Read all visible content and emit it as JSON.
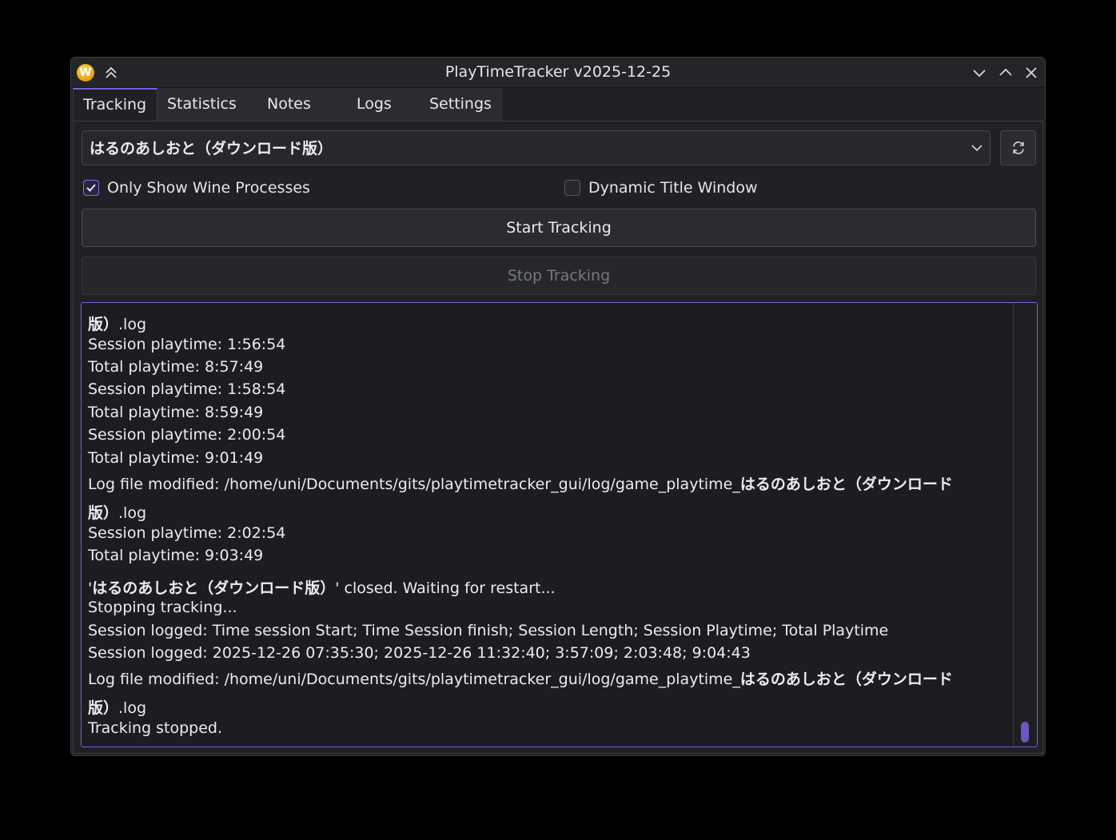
{
  "window": {
    "title": "PlayTimeTracker v2025-12-25",
    "app_icon_letter": "W",
    "icons": {
      "app": "wine-app-icon",
      "keep_above": "double-chevron-up-icon",
      "minimize": "chevron-down-icon",
      "maximize": "chevron-up-icon",
      "close": "close-icon"
    }
  },
  "tabs": [
    {
      "label": "Tracking",
      "active": true
    },
    {
      "label": "Statistics",
      "active": false
    },
    {
      "label": "Notes",
      "active": false
    },
    {
      "label": "Logs",
      "active": false
    },
    {
      "label": "Settings",
      "active": false
    }
  ],
  "tracking": {
    "process_select": {
      "selected": "はるのあしおと（ダウンロード版）",
      "arrow_icon": "chevron-down-icon"
    },
    "refresh_icon": "refresh-icon",
    "only_wine": {
      "label": "Only Show Wine Processes",
      "checked": true
    },
    "dynamic_title": {
      "label": "Dynamic Title Window",
      "checked": false
    },
    "start_label": "Start Tracking",
    "stop_label": "Stop Tracking",
    "stop_enabled": false
  },
  "log": {
    "lines": [
      "版）.log",
      "Session playtime: 1:56:54",
      "Total playtime: 8:57:49",
      "Session playtime: 1:58:54",
      "Total playtime: 8:59:49",
      "Session playtime: 2:00:54",
      "Total playtime: 9:01:49",
      "Log file modified: /home/uni/Documents/gits/playtimetracker_gui/log/game_playtime_はるのあしおと（ダウンロード",
      "版）.log",
      "Session playtime: 2:02:54",
      "Total playtime: 9:03:49",
      "'はるのあしおと（ダウンロード版）' closed. Waiting for restart...",
      "Stopping tracking...",
      "Session logged: Time session Start; Time Session finish; Session Length; Session Playtime; Total Playtime",
      "Session logged: 2025-12-26 07:35:30; 2025-12-26 11:32:40; 3:57:09; 2:03:48; 9:04:43",
      "Log file modified: /home/uni/Documents/gits/playtimetracker_gui/log/game_playtime_はるのあしおと（ダウンロード",
      "版）.log",
      "Tracking stopped."
    ]
  },
  "colors": {
    "accent": "#7c5fd8",
    "background": "#1f2124",
    "text": "#ececec",
    "disabled_text": "#77797e"
  }
}
